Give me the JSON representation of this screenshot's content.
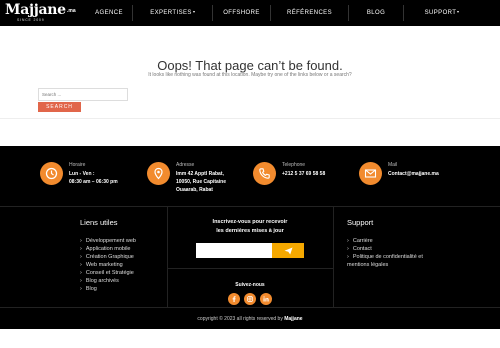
{
  "brand": {
    "word": "Majjane",
    "suffix": ".ma",
    "tagline": "SINCE 2009"
  },
  "nav": {
    "items": [
      {
        "label": "AGENCE",
        "dropdown": false
      },
      {
        "label": "EXPERTISES",
        "dropdown": true
      },
      {
        "label": "OFFSHORE",
        "dropdown": false
      },
      {
        "label": "RÉFÉRENCES",
        "dropdown": false
      },
      {
        "label": "BLOG",
        "dropdown": false
      },
      {
        "label": "SUPPORT",
        "dropdown": true
      }
    ]
  },
  "not_found": {
    "title": "Oops! That page can’t be found.",
    "subtitle": "It looks like nothing was found at this location. Maybe try one of the links below or a search?",
    "search_placeholder": "Search ...",
    "search_button": "SEARCH"
  },
  "contacts": [
    {
      "label": "Horaire",
      "line1": "Lun - Ven :",
      "line2": "08:30 am – 06:30 pm",
      "line3": "",
      "icon": "clock-icon"
    },
    {
      "label": "Adresse",
      "line1": "Imm 42 Apptl Rabat,",
      "line2": "10050, Rue Capitaine",
      "line3": "Ouaarab, Rabat",
      "icon": "location-icon"
    },
    {
      "label": "Telephone",
      "line1": "+212 5 37 69 58 58",
      "line2": "",
      "line3": "",
      "icon": "phone-icon"
    },
    {
      "label": "Mail",
      "line1": "Contact@majjane.ma",
      "line2": "",
      "line3": "",
      "icon": "mail-icon"
    }
  ],
  "useful_links": {
    "title": "Liens utiles",
    "items": [
      "Développement web",
      "Application mobile",
      "Création Graphique",
      "Web marketing",
      "Conseil et Stratégie",
      "Blog archivés",
      "Blog"
    ]
  },
  "newsletter": {
    "line1": "Inscrivez-vous pour recevoir",
    "line2": "les dernières mises à jour"
  },
  "follow": {
    "title": "Suivez-nous",
    "networks": [
      "facebook-icon",
      "instagram-icon",
      "linkedin-icon"
    ]
  },
  "support": {
    "title": "Support",
    "items": [
      "Carrière",
      "Contact",
      "Politique de confidentialité et",
      "mentions légales"
    ]
  },
  "copyright": {
    "text": "copyright © 2023 all rights reserved by",
    "brand": "Majjane"
  },
  "colors": {
    "accent_orange": "#f28b2e",
    "search_button": "#e1664a",
    "newsletter_button": "#f5a800",
    "footer_bg": "#000000"
  }
}
